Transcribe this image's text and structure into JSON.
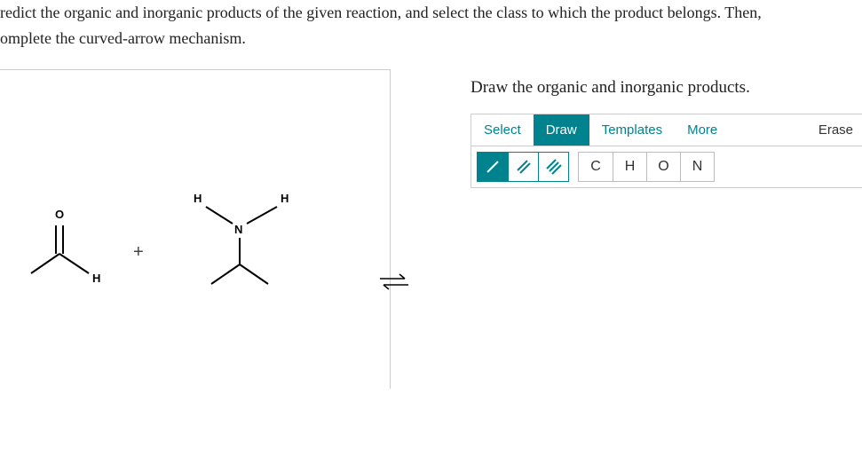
{
  "question": {
    "line1": "redict the organic and inorganic products of the given reaction, and select the class to which the product belongs. Then,",
    "line2": "omplete the curved-arrow mechanism."
  },
  "draw_panel": {
    "title": "Draw the organic and inorganic products."
  },
  "tabs": {
    "select": "Select",
    "draw": "Draw",
    "templates": "Templates",
    "more": "More",
    "erase": "Erase"
  },
  "elements": {
    "c": "C",
    "h": "H",
    "o": "O",
    "n": "N"
  },
  "atoms": {
    "o_label": "O",
    "h_label": "H",
    "n_label": "N"
  },
  "plus": "+"
}
